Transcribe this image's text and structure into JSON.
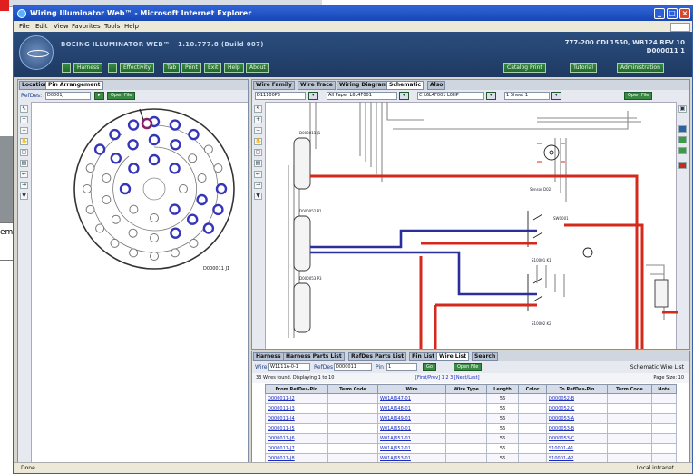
{
  "window": {
    "title": "Wiring Illuminator Web™ - Microsoft Internet Explorer",
    "menu": [
      "File",
      "Edit",
      "View",
      "Favorites",
      "Tools",
      "Help"
    ]
  },
  "header": {
    "app_name": "BOEING ILLUMINATOR WEB™",
    "version": "1.10.777.8 (Build 007)",
    "right_line1": "777-200 CDL1550, WB124 REV 10",
    "right_line2": "D000011 1",
    "nav": [
      "Harness",
      "Effectivity",
      "Tab",
      "Print",
      "Exit",
      "Help",
      "About"
    ],
    "nav_right": [
      "Catalog Print",
      "Tutorial",
      "Administration"
    ]
  },
  "left_panel": {
    "tabs": [
      "Location",
      "Pin Arrangement"
    ],
    "refdes_label": "RefDes:",
    "refdes_value": "D0001J",
    "open_label": "Open File",
    "connector_caption": "D000011 J1"
  },
  "right_panel": {
    "tabs": [
      "Wire Family",
      "Wire Trace",
      "Wiring Diagram",
      "Schematic",
      "Also"
    ],
    "filters": [
      "D11100P3",
      "All Paper L6L4F001",
      "C L6L4F001 L0HP",
      "1 Sheet 1"
    ],
    "open_label": "Open File",
    "labels": [
      "D000011 J1",
      "D000052 P1",
      "D000052 P2",
      "D000053 P3",
      "S10001 K1",
      "S10002 K2",
      "SW0001",
      "Sensor D02"
    ]
  },
  "bottom_panel": {
    "tabs": [
      "Harness",
      "Harness Parts List",
      "RefDes Parts List",
      "Pin List",
      "Wire List",
      "Search"
    ],
    "active_tab": "Wire List",
    "wire_label": "Wire",
    "wire_value": "W1111A-0-1",
    "refdes_label": "RefDes",
    "refdes_value": "D000011",
    "pin_label": "Pin",
    "pin_value": "1",
    "go_label": "Go",
    "open_label": "Open File",
    "schematic_label": "Schematic Wire List",
    "found_text": "33 Wires found. Displaying 1 to 10",
    "pages_text": "[First/Prev] 1 2 3 [Next/Last]",
    "page_size_text": "Page Size: 10",
    "columns": [
      "From RefDes-Pin",
      "Term Code",
      "Wire",
      "Wire Type",
      "Length",
      "Color",
      "To RefDes-Pin",
      "Term Code",
      "Note"
    ],
    "rows": [
      [
        "D000011-J2",
        "",
        "W01AJ647-01",
        "",
        "56",
        "",
        "D000052-B",
        ""
      ],
      [
        "D000011-J3",
        "",
        "W01AJ648-01",
        "",
        "56",
        "",
        "D000052-C",
        ""
      ],
      [
        "D000011-J4",
        "",
        "W01AJ649-01",
        "",
        "56",
        "",
        "D000053-A",
        ""
      ],
      [
        "D000011-J5",
        "",
        "W01AJ650-01",
        "",
        "56",
        "",
        "D000053-B",
        ""
      ],
      [
        "D000011-J6",
        "",
        "W01AJ651-01",
        "",
        "56",
        "",
        "D000053-C",
        ""
      ],
      [
        "D000011-J7",
        "",
        "W01AJ652-01",
        "",
        "56",
        "",
        "S10001-A1",
        ""
      ],
      [
        "D000011-J8",
        "",
        "W01AJ653-01",
        "",
        "56",
        "",
        "S10001-A2",
        ""
      ],
      [
        "D000011-J9",
        "",
        "W01AJ654-01",
        "",
        "56",
        "",
        "S10002-B1",
        ""
      ]
    ]
  },
  "status": {
    "left": "Done",
    "right": "Local intranet"
  },
  "background": {
    "fragment": "em"
  },
  "colors": {
    "titlebar": "#1646b4",
    "header": "#23436f",
    "nav_green": "#2f7a3a",
    "wire_red": "#d42a1e",
    "wire_blue": "#2a2f9c"
  }
}
